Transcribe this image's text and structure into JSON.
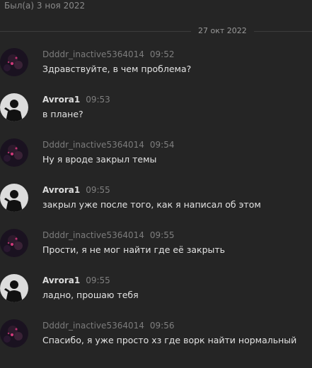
{
  "header": {
    "status": "Был(а) 3 ноя 2022"
  },
  "date_separator": "27 окт 2022",
  "avatars": {
    "user1": "dark-pink-avatar-icon",
    "user2": "black-silhouette-avatar-icon"
  },
  "messages": [
    {
      "author": "Ddddr_inactive5364014",
      "time": "09:52",
      "text": "Здравствуйте, в чем проблема?"
    },
    {
      "author": "Avrora1",
      "time": "09:53",
      "text": "в плане?"
    },
    {
      "author": "Ddddr_inactive5364014",
      "time": "09:54",
      "text": "Ну я вроде закрыл темы"
    },
    {
      "author": "Avrora1",
      "time": "09:55",
      "text": "закрыл уже после того, как я написал об этом"
    },
    {
      "author": "Ddddr_inactive5364014",
      "time": "09:55",
      "text": "Прости, я не мог найти где её закрыть"
    },
    {
      "author": "Avrora1",
      "time": "09:55",
      "text": "ладно, прошаю тебя"
    },
    {
      "author": "Ddddr_inactive5364014",
      "time": "09:56",
      "text": "Спасибо, я уже просто хз где ворк найти нормальный"
    }
  ]
}
